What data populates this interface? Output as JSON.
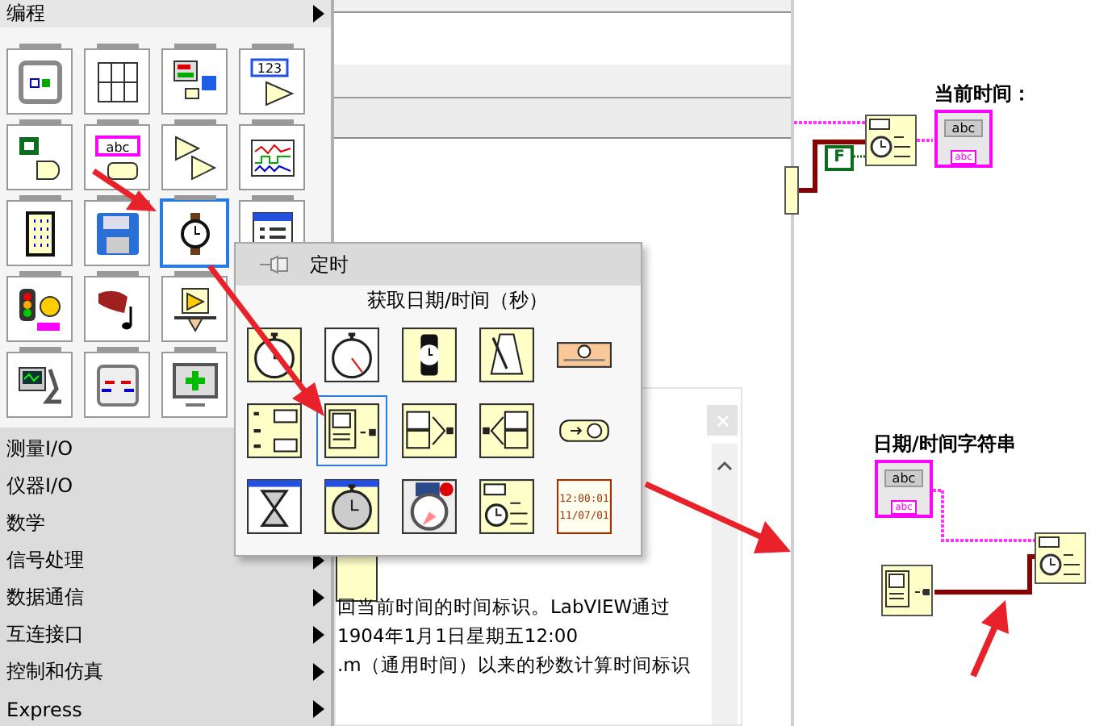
{
  "palette": {
    "title": "编程",
    "has_submenu": true,
    "icon_rows": [
      [
        {
          "kind": "structure",
          "selected": false
        },
        {
          "kind": "array",
          "selected": false
        },
        {
          "kind": "cluster",
          "selected": false
        },
        {
          "kind": "numeric",
          "selected": false,
          "text": "123"
        }
      ],
      [
        {
          "kind": "boolean",
          "selected": false
        },
        {
          "kind": "string",
          "selected": false,
          "text": "abc"
        },
        {
          "kind": "comparison",
          "selected": false
        },
        {
          "kind": "waveform",
          "selected": false
        }
      ],
      [
        {
          "kind": "keypad",
          "selected": false
        },
        {
          "kind": "file",
          "selected": false
        },
        {
          "kind": "timing",
          "selected": true
        },
        {
          "kind": "dialog",
          "selected": false
        }
      ],
      [
        {
          "kind": "error",
          "selected": false
        },
        {
          "kind": "sound",
          "selected": false
        },
        {
          "kind": "tray",
          "selected": false
        }
      ],
      [
        {
          "kind": "report",
          "selected": false
        },
        {
          "kind": "sync",
          "selected": false
        },
        {
          "kind": "graphics",
          "selected": false
        }
      ]
    ]
  },
  "menu_items": [
    {
      "label": "测量I/O"
    },
    {
      "label": "仪器I/O"
    },
    {
      "label": "数学"
    },
    {
      "label": "信号处理",
      "submenu": true
    },
    {
      "label": "数据通信",
      "submenu": true
    },
    {
      "label": "互连接口",
      "submenu": true
    },
    {
      "label": "控制和仿真",
      "submenu": true
    },
    {
      "label": "Express",
      "submenu": true
    }
  ],
  "popup": {
    "title": "定时",
    "caption": "获取日期/时间（秒）",
    "icons": [
      {
        "kind": "stopwatch",
        "selected": false
      },
      {
        "kind": "chrono",
        "selected": false
      },
      {
        "kind": "wristwatch",
        "selected": false
      },
      {
        "kind": "metronome",
        "selected": false
      },
      {
        "kind": "timeline",
        "selected": false
      },
      {
        "kind": "format",
        "selected": false
      },
      {
        "kind": "datetime",
        "selected": true
      },
      {
        "kind": "split",
        "selected": false
      },
      {
        "kind": "join",
        "selected": false
      },
      {
        "kind": "convert",
        "selected": false
      },
      {
        "kind": "hourglass",
        "selected": false
      },
      {
        "kind": "wait",
        "selected": false
      },
      {
        "kind": "alarm",
        "selected": false
      },
      {
        "kind": "formatdate",
        "selected": false
      },
      {
        "kind": "timestamp",
        "selected": false,
        "lines": [
          "12:00:01",
          "11/07/01"
        ]
      }
    ]
  },
  "help": {
    "lines": [
      "回当前时间的时间标识。LabVIEW通过",
      "1904年1月1日星期五12:00",
      ".m（通用时间）以来的秒数计算时间标识"
    ]
  },
  "diagram": {
    "time_label": "当前时间：",
    "time_indicator": {
      "value": "abc",
      "badge": "abc"
    },
    "constant": "F",
    "string_label": "日期/时间字符串",
    "string_indicator": {
      "value": "abc",
      "badge": "abc"
    }
  }
}
